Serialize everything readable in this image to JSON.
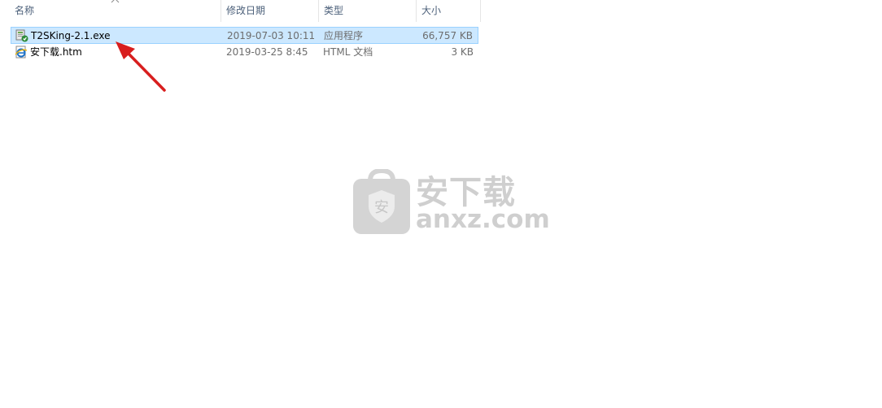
{
  "columns": {
    "name": "名称",
    "date": "修改日期",
    "type": "类型",
    "size": "大小"
  },
  "files": [
    {
      "name": "T2SKing-2.1.exe",
      "date": "2019-07-03 10:11",
      "type": "应用程序",
      "size": "66,757 KB",
      "icon": "exe-installer-icon",
      "selected": true
    },
    {
      "name": "安下载.htm",
      "date": "2019-03-25 8:45",
      "type": "HTML 文档",
      "size": "3 KB",
      "icon": "internet-explorer-icon",
      "selected": false
    }
  ],
  "watermark": {
    "cn": "安下载",
    "en": "anxz.com",
    "badge": "安"
  },
  "colors": {
    "selection_bg": "#cce8ff",
    "selection_border": "#99d1ff",
    "arrow": "#d81e1e",
    "header_text": "#4c607a"
  }
}
